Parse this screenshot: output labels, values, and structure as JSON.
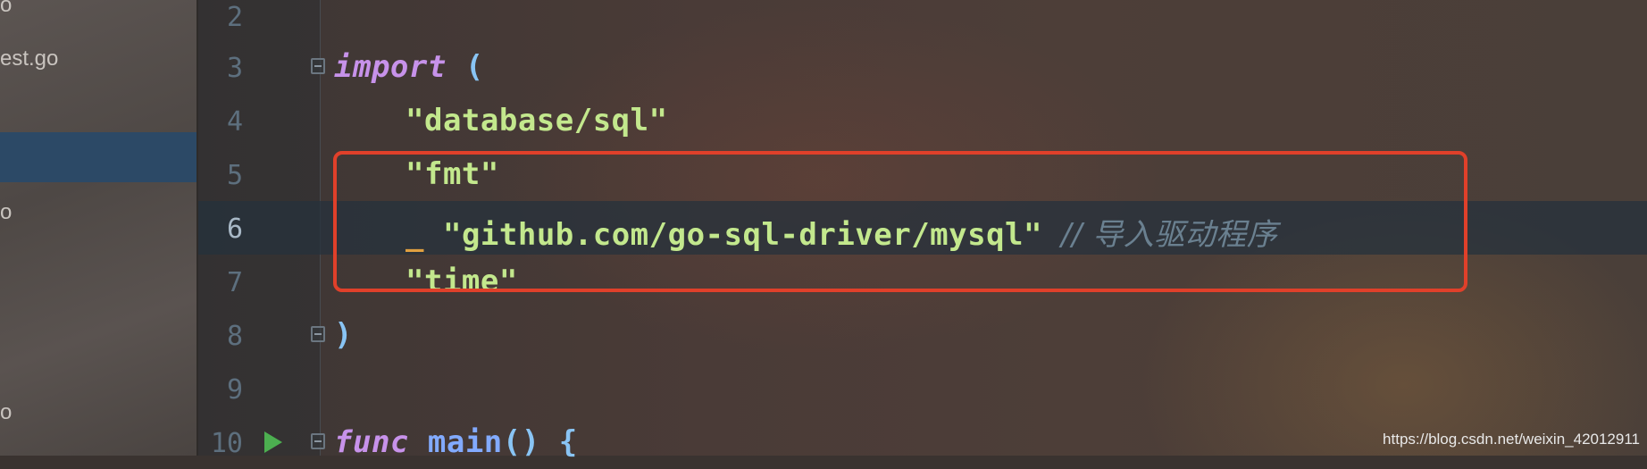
{
  "project_tree": {
    "items": [
      {
        "label": "o",
        "selected": false
      },
      {
        "label": "est.go",
        "selected": false
      },
      {
        "label": "",
        "selected": true
      },
      {
        "label": "o",
        "selected": false
      },
      {
        "label": "o",
        "selected": false
      }
    ]
  },
  "editor": {
    "lines": [
      {
        "number": "2"
      },
      {
        "number": "3",
        "keyword": "import",
        "paren": "("
      },
      {
        "number": "4",
        "string": "\"database/sql\""
      },
      {
        "number": "5",
        "string": "\"fmt\""
      },
      {
        "number": "6",
        "blank_id": "_",
        "string": "\"github.com/go-sql-driver/mysql\"",
        "comment": "// 导入驱动程序"
      },
      {
        "number": "7",
        "string": "\"time\""
      },
      {
        "number": "8",
        "paren": ")"
      },
      {
        "number": "9"
      },
      {
        "number": "10",
        "keyword": "func",
        "name": "main",
        "parens": "()",
        "brace": "{"
      }
    ]
  },
  "watermark": "https://blog.csdn.net/weixin_42012911",
  "colors": {
    "keyword": "#c792ea",
    "string": "#c3e88d",
    "function": "#82aaff",
    "comment": "#6a8090",
    "highlight_border": "#e0402a",
    "run_icon": "#4caf50",
    "selection": "#2c4966"
  }
}
